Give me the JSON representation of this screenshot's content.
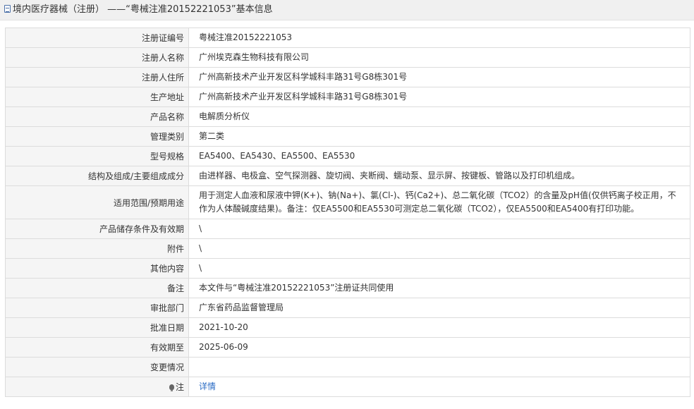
{
  "header": {
    "title": "境内医疗器械（注册） ——“粤械注准20152221053”基本信息"
  },
  "rows": [
    {
      "label": "注册证编号",
      "value": "粤械注准20152221053"
    },
    {
      "label": "注册人名称",
      "value": "广州埃克森生物科技有限公司"
    },
    {
      "label": "注册人住所",
      "value": "广州高新技术产业开发区科学城科丰路31号G8栋301号"
    },
    {
      "label": "生产地址",
      "value": "广州高新技术产业开发区科学城科丰路31号G8栋301号"
    },
    {
      "label": "产品名称",
      "value": "电解质分析仪"
    },
    {
      "label": "管理类别",
      "value": "第二类"
    },
    {
      "label": "型号规格",
      "value": "EA5400、EA5430、EA5500、EA5530"
    },
    {
      "label": "结构及组成/主要组成成分",
      "value": "由进样器、电极盒、空气探测器、旋切阀、夹断阀、蠕动泵、显示屏、按键板、管路以及打印机组成。"
    },
    {
      "label": "适用范围/预期用途",
      "value": "用于测定人血液和尿液中钾(K+)、钠(Na+)、氯(Cl-)、钙(Ca2+)、总二氧化碳（TCO2）的含量及pH值(仅供钙离子校正用，不作为人体酸碱度结果)。备注：仅EA5500和EA5530可测定总二氧化碳（TCO2），仅EA5500和EA5400有打印功能。"
    },
    {
      "label": "产品储存条件及有效期",
      "value": "\\"
    },
    {
      "label": "附件",
      "value": "\\"
    },
    {
      "label": "其他内容",
      "value": "\\"
    },
    {
      "label": "备注",
      "value": "本文件与“粤械注准20152221053”注册证共同使用"
    },
    {
      "label": "审批部门",
      "value": "广东省药品监督管理局"
    },
    {
      "label": "批准日期",
      "value": "2021-10-20"
    },
    {
      "label": "有效期至",
      "value": "2025-06-09"
    },
    {
      "label": "变更情况",
      "value": ""
    }
  ],
  "note": {
    "label": "注",
    "link": "详情"
  }
}
